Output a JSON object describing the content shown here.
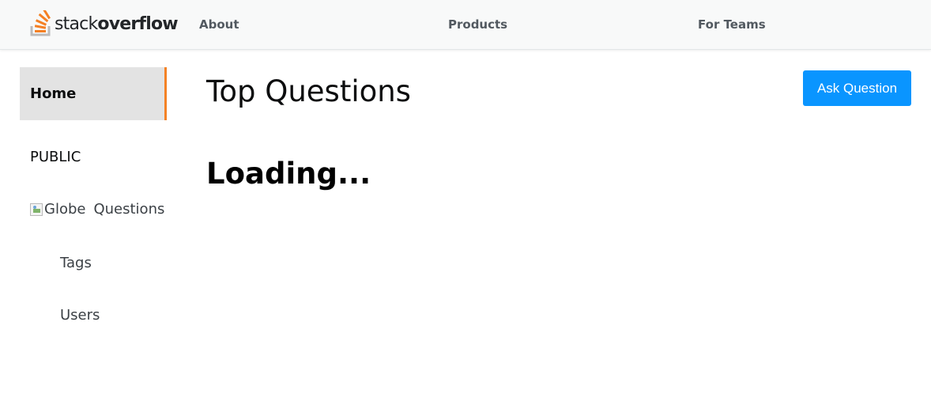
{
  "header": {
    "logo": {
      "text_regular": "stack",
      "text_bold": "overflow",
      "icon": "stackoverflow-logo-icon"
    },
    "nav": [
      {
        "label": "About"
      },
      {
        "label": "Products"
      },
      {
        "label": "For Teams"
      }
    ]
  },
  "sidebar": {
    "home_label": "Home",
    "section_label": "PUBLIC",
    "questions": {
      "broken_image_alt": "Globe",
      "label": "Questions"
    },
    "tags_label": "Tags",
    "users_label": "Users"
  },
  "main": {
    "title": "Top Questions",
    "ask_button": "Ask Question",
    "status": "Loading..."
  },
  "colors": {
    "accent_orange": "#f48225",
    "button_blue": "#0a95ff",
    "topbar_bg": "#f8f9f9",
    "active_item_bg": "#e3e3e3"
  }
}
